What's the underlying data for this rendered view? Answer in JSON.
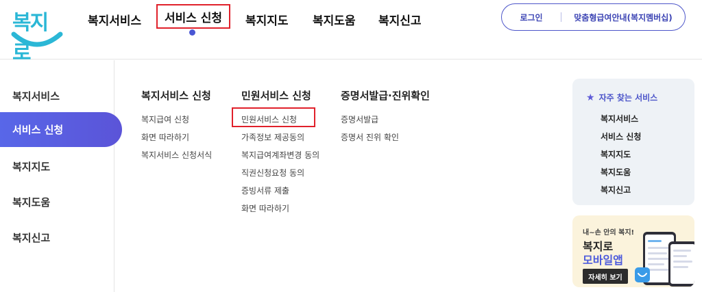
{
  "logo": {
    "text": "복지로"
  },
  "gnb": {
    "items": [
      {
        "label": "복지서비스"
      },
      {
        "label": "서비스 신청"
      },
      {
        "label": "복지지도"
      },
      {
        "label": "복지도움"
      },
      {
        "label": "복지신고"
      }
    ]
  },
  "util": {
    "login": "로그인",
    "custom": "맞춤형급여안내(복지멤버십)"
  },
  "side": {
    "items": [
      {
        "label": "복지서비스"
      },
      {
        "label": "서비스 신청"
      },
      {
        "label": "복지지도"
      },
      {
        "label": "복지도움"
      },
      {
        "label": "복지신고"
      }
    ]
  },
  "columns": [
    {
      "title": "복지서비스 신청",
      "links": [
        "복지급여 신청",
        "화면 따라하기",
        "복지서비스 신청서식"
      ]
    },
    {
      "title": "민원서비스 신청",
      "links": [
        "민원서비스 신청",
        "가족정보 제공동의",
        "복지급여계좌변경 동의",
        "직권신청요청 동의",
        "증빙서류 제출",
        "화면 따라하기"
      ]
    },
    {
      "title": "증명서발급·진위확인",
      "links": [
        "증명서발급",
        "증명서 진위 확인"
      ]
    }
  ],
  "favorites": {
    "title": "자주 찾는 서비스",
    "items": [
      "복지서비스",
      "서비스 신청",
      "복지지도",
      "복지도움",
      "복지신고"
    ]
  },
  "banner": {
    "small": "내~손 안의 복지!",
    "line1": "복지로",
    "line2": "모바일앱",
    "button": "자세히 보기"
  },
  "colors": {
    "accent": "#4b54c9",
    "highlight": "#e0202a",
    "logo": "#2bb7d6"
  }
}
